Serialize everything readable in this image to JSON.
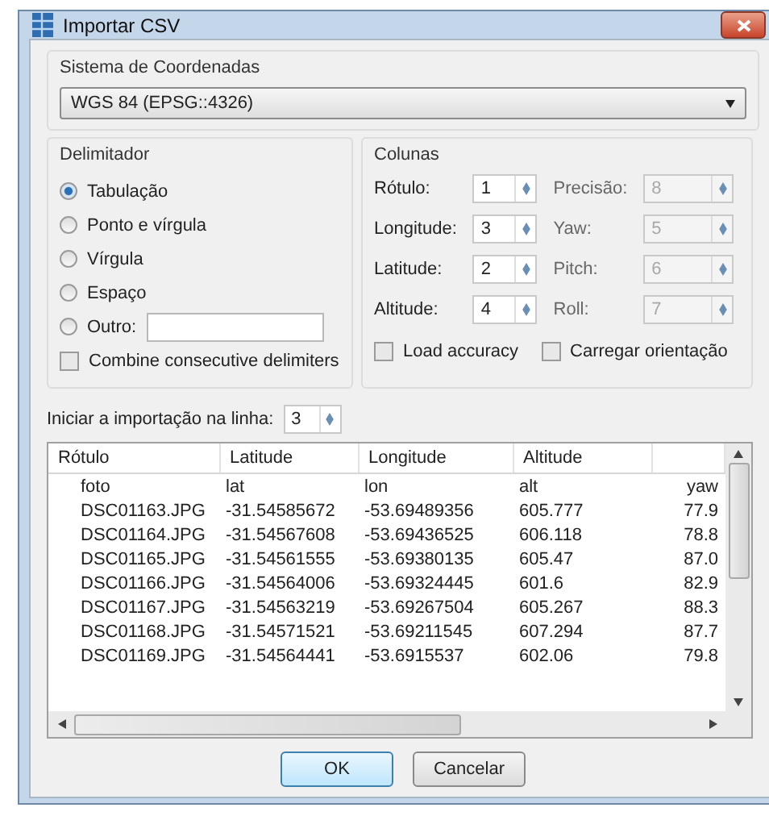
{
  "window": {
    "title": "Importar CSV"
  },
  "coordinate_system": {
    "label": "Sistema de Coordenadas",
    "value": "WGS 84 (EPSG::4326)"
  },
  "delimiter": {
    "label": "Delimitador",
    "options": [
      {
        "label": "Tabulação",
        "selected": true,
        "kind": "radio"
      },
      {
        "label": "Ponto e vírgula",
        "selected": false,
        "kind": "radio"
      },
      {
        "label": "Vírgula",
        "selected": false,
        "kind": "radio"
      },
      {
        "label": "Espaço",
        "selected": false,
        "kind": "radio"
      },
      {
        "label": "Outro:",
        "selected": false,
        "kind": "radio_field"
      }
    ],
    "combine": {
      "label": "Combine consecutive delimiters",
      "checked": false
    }
  },
  "columns": {
    "label": "Colunas",
    "fields": [
      {
        "label": "Rótulo:",
        "value": "1",
        "disabled": false
      },
      {
        "label": "Precisão:",
        "value": "8",
        "disabled": true
      },
      {
        "label": "Longitude:",
        "value": "3",
        "disabled": false
      },
      {
        "label": "Yaw:",
        "value": "5",
        "disabled": true
      },
      {
        "label": "Latitude:",
        "value": "2",
        "disabled": false
      },
      {
        "label": "Pitch:",
        "value": "6",
        "disabled": true
      },
      {
        "label": "Altitude:",
        "value": "4",
        "disabled": false
      },
      {
        "label": "Roll:",
        "value": "7",
        "disabled": true
      }
    ],
    "checks": [
      {
        "label": "Load accuracy",
        "checked": false
      },
      {
        "label": "Carregar orientação",
        "checked": false
      }
    ]
  },
  "start_line": {
    "label": "Iniciar a importação na linha:",
    "value": "3"
  },
  "table": {
    "columns": [
      "Rótulo",
      "Latitude",
      "Longitude",
      "Altitude",
      ""
    ],
    "rows": [
      [
        "foto",
        "lat",
        "lon",
        "alt",
        "yaw"
      ],
      [
        "DSC01163.JPG",
        "-31.54585672",
        "-53.69489356",
        "605.777",
        "77.9"
      ],
      [
        "DSC01164.JPG",
        "-31.54567608",
        "-53.69436525",
        "606.118",
        "78.8"
      ],
      [
        "DSC01165.JPG",
        "-31.54561555",
        "-53.69380135",
        "605.47",
        "87.0"
      ],
      [
        "DSC01166.JPG",
        "-31.54564006",
        "-53.69324445",
        "601.6",
        "82.9"
      ],
      [
        "DSC01167.JPG",
        "-31.54563219",
        "-53.69267504",
        "605.267",
        "88.3"
      ],
      [
        "DSC01168.JPG",
        "-31.54571521",
        "-53.69211545",
        "607.294",
        "87.7"
      ],
      [
        "DSC01169.JPG",
        "-31.54564441",
        "-53.6915537",
        "602.06",
        "79.8"
      ]
    ]
  },
  "buttons": [
    {
      "label": "OK",
      "kind": "default"
    },
    {
      "label": "Cancelar",
      "kind": "normal"
    }
  ]
}
